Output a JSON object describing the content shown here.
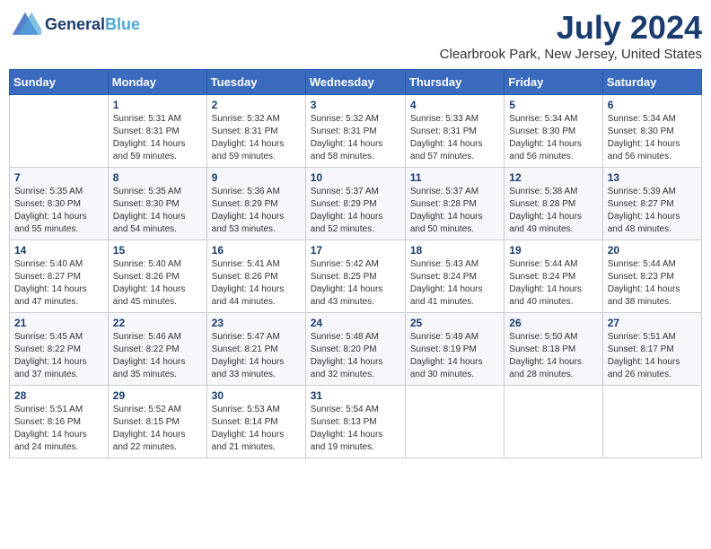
{
  "logo": {
    "line1": "General",
    "line2": "Blue"
  },
  "title": "July 2024",
  "location": "Clearbrook Park, New Jersey, United States",
  "days_of_week": [
    "Sunday",
    "Monday",
    "Tuesday",
    "Wednesday",
    "Thursday",
    "Friday",
    "Saturday"
  ],
  "weeks": [
    [
      {
        "day": "",
        "info": ""
      },
      {
        "day": "1",
        "info": "Sunrise: 5:31 AM\nSunset: 8:31 PM\nDaylight: 14 hours\nand 59 minutes."
      },
      {
        "day": "2",
        "info": "Sunrise: 5:32 AM\nSunset: 8:31 PM\nDaylight: 14 hours\nand 59 minutes."
      },
      {
        "day": "3",
        "info": "Sunrise: 5:32 AM\nSunset: 8:31 PM\nDaylight: 14 hours\nand 58 minutes."
      },
      {
        "day": "4",
        "info": "Sunrise: 5:33 AM\nSunset: 8:31 PM\nDaylight: 14 hours\nand 57 minutes."
      },
      {
        "day": "5",
        "info": "Sunrise: 5:34 AM\nSunset: 8:30 PM\nDaylight: 14 hours\nand 56 minutes."
      },
      {
        "day": "6",
        "info": "Sunrise: 5:34 AM\nSunset: 8:30 PM\nDaylight: 14 hours\nand 56 minutes."
      }
    ],
    [
      {
        "day": "7",
        "info": "Sunrise: 5:35 AM\nSunset: 8:30 PM\nDaylight: 14 hours\nand 55 minutes."
      },
      {
        "day": "8",
        "info": "Sunrise: 5:35 AM\nSunset: 8:30 PM\nDaylight: 14 hours\nand 54 minutes."
      },
      {
        "day": "9",
        "info": "Sunrise: 5:36 AM\nSunset: 8:29 PM\nDaylight: 14 hours\nand 53 minutes."
      },
      {
        "day": "10",
        "info": "Sunrise: 5:37 AM\nSunset: 8:29 PM\nDaylight: 14 hours\nand 52 minutes."
      },
      {
        "day": "11",
        "info": "Sunrise: 5:37 AM\nSunset: 8:28 PM\nDaylight: 14 hours\nand 50 minutes."
      },
      {
        "day": "12",
        "info": "Sunrise: 5:38 AM\nSunset: 8:28 PM\nDaylight: 14 hours\nand 49 minutes."
      },
      {
        "day": "13",
        "info": "Sunrise: 5:39 AM\nSunset: 8:27 PM\nDaylight: 14 hours\nand 48 minutes."
      }
    ],
    [
      {
        "day": "14",
        "info": "Sunrise: 5:40 AM\nSunset: 8:27 PM\nDaylight: 14 hours\nand 47 minutes."
      },
      {
        "day": "15",
        "info": "Sunrise: 5:40 AM\nSunset: 8:26 PM\nDaylight: 14 hours\nand 45 minutes."
      },
      {
        "day": "16",
        "info": "Sunrise: 5:41 AM\nSunset: 8:26 PM\nDaylight: 14 hours\nand 44 minutes."
      },
      {
        "day": "17",
        "info": "Sunrise: 5:42 AM\nSunset: 8:25 PM\nDaylight: 14 hours\nand 43 minutes."
      },
      {
        "day": "18",
        "info": "Sunrise: 5:43 AM\nSunset: 8:24 PM\nDaylight: 14 hours\nand 41 minutes."
      },
      {
        "day": "19",
        "info": "Sunrise: 5:44 AM\nSunset: 8:24 PM\nDaylight: 14 hours\nand 40 minutes."
      },
      {
        "day": "20",
        "info": "Sunrise: 5:44 AM\nSunset: 8:23 PM\nDaylight: 14 hours\nand 38 minutes."
      }
    ],
    [
      {
        "day": "21",
        "info": "Sunrise: 5:45 AM\nSunset: 8:22 PM\nDaylight: 14 hours\nand 37 minutes."
      },
      {
        "day": "22",
        "info": "Sunrise: 5:46 AM\nSunset: 8:22 PM\nDaylight: 14 hours\nand 35 minutes."
      },
      {
        "day": "23",
        "info": "Sunrise: 5:47 AM\nSunset: 8:21 PM\nDaylight: 14 hours\nand 33 minutes."
      },
      {
        "day": "24",
        "info": "Sunrise: 5:48 AM\nSunset: 8:20 PM\nDaylight: 14 hours\nand 32 minutes."
      },
      {
        "day": "25",
        "info": "Sunrise: 5:49 AM\nSunset: 8:19 PM\nDaylight: 14 hours\nand 30 minutes."
      },
      {
        "day": "26",
        "info": "Sunrise: 5:50 AM\nSunset: 8:18 PM\nDaylight: 14 hours\nand 28 minutes."
      },
      {
        "day": "27",
        "info": "Sunrise: 5:51 AM\nSunset: 8:17 PM\nDaylight: 14 hours\nand 26 minutes."
      }
    ],
    [
      {
        "day": "28",
        "info": "Sunrise: 5:51 AM\nSunset: 8:16 PM\nDaylight: 14 hours\nand 24 minutes."
      },
      {
        "day": "29",
        "info": "Sunrise: 5:52 AM\nSunset: 8:15 PM\nDaylight: 14 hours\nand 22 minutes."
      },
      {
        "day": "30",
        "info": "Sunrise: 5:53 AM\nSunset: 8:14 PM\nDaylight: 14 hours\nand 21 minutes."
      },
      {
        "day": "31",
        "info": "Sunrise: 5:54 AM\nSunset: 8:13 PM\nDaylight: 14 hours\nand 19 minutes."
      },
      {
        "day": "",
        "info": ""
      },
      {
        "day": "",
        "info": ""
      },
      {
        "day": "",
        "info": ""
      }
    ]
  ]
}
